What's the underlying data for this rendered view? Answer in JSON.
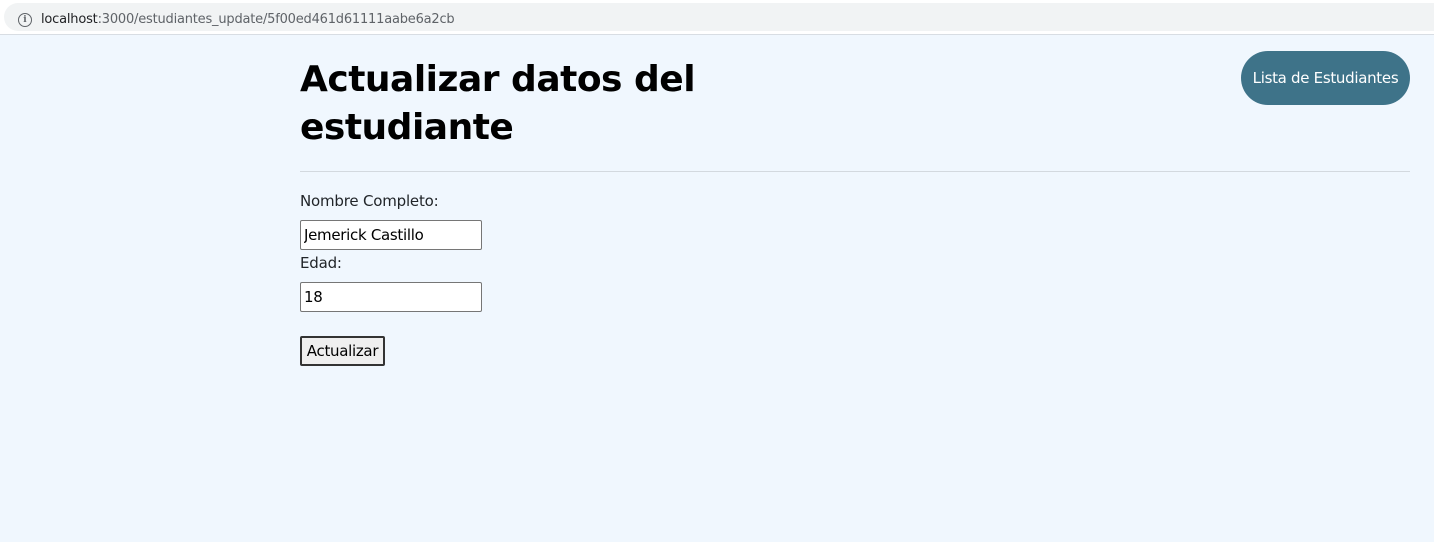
{
  "browser": {
    "url_host": "localhost",
    "url_path": ":3000/estudiantes_update/5f00ed461d61111aabe6a2cb",
    "info_icon": "info-icon"
  },
  "header": {
    "title": "Actualizar datos del estudiante",
    "nav_button_label": "Lista de Estudiantes",
    "nav_button_color": "#3e7389"
  },
  "form": {
    "nombre_label": "Nombre Completo:",
    "nombre_value": "Jemerick Castillo",
    "edad_label": "Edad:",
    "edad_value": "18",
    "submit_label": "Actualizar"
  }
}
